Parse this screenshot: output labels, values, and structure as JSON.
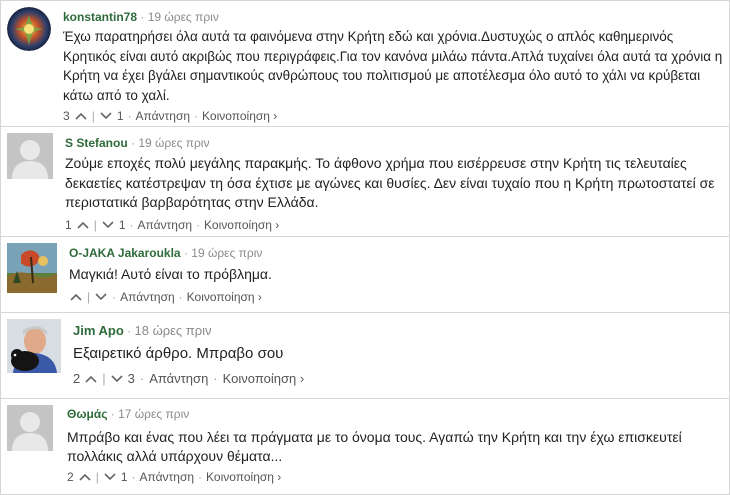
{
  "comments": [
    {
      "author": "konstantin78",
      "separator": "·",
      "time": "19 ώρες πριν",
      "avatar_icon": "colorful-circular-avatar",
      "text": "Έχω παρατηρήσει όλα αυτά τα φαινόμενα στην Κρήτη εδώ και χρόνια.Δυστυχώς ο απλός καθημερινός Κρητικός είναι αυτό ακριβώς που περιγράφεις.Για τον κανόνα μιλάω πάντα.Απλά τυχαίνει όλα αυτά τα χρόνια η Κρήτη να έχει βγάλει σημαντικούς ανθρώπους του πολιτισμού με αποτέλεσμα όλο αυτό το χάλι να κρύβεται κάτω από το χαλί.",
      "upvotes": "3",
      "downvotes": "1",
      "reply_label": "Απάντηση",
      "share_label": "Κοινοποίηση ›"
    },
    {
      "author": "S Stefanou",
      "separator": "·",
      "time": "19 ώρες πριν",
      "avatar_icon": "default-user-silhouette",
      "text": "Ζούμε εποχές πολύ μεγάλης παρακμής. Το άφθονο χρήμα που εισέρρευσε στην Κρήτη τις τελευταίες δεκαετίες κατέστρεψαν τη όσα έχτισε με αγώνες και θυσίες. Δεν είναι τυχαίο που η Κρήτη πρωτοστατεί σε περιστατικά βαρβαρότητας στην Ελλάδα.",
      "upvotes": "1",
      "downvotes": "1",
      "reply_label": "Απάντηση",
      "share_label": "Κοινοποίηση ›"
    },
    {
      "author": "O-JAKA Jakaroukla",
      "separator": "·",
      "time": "19 ώρες πριν",
      "avatar_icon": "painting-avatar",
      "text": "Μαγκιά! Αυτό είναι το πρόβλημα.",
      "upvotes": "",
      "downvotes": "",
      "reply_label": "Απάντηση",
      "share_label": "Κοινοποίηση ›"
    },
    {
      "author": "Jim Apo",
      "separator": "·",
      "time": "18 ώρες πριν",
      "avatar_icon": "photo-man-with-dog-avatar",
      "text": "Εξαιρετικό άρθρο. Μπραβο σου",
      "upvotes": "2",
      "downvotes": "3",
      "reply_label": "Απάντηση",
      "share_label": "Κοινοποίηση ›"
    },
    {
      "author": "Θωμάς",
      "separator": "·",
      "time": "17 ώρες πριν",
      "avatar_icon": "default-user-silhouette",
      "text": "Μπράβο και ένας που λέει τα πράγματα με το όνομα τους. Αγαπώ την Κρήτη και την έχω επισκευτεί πολλάκις αλλά υπάρχουν θέματα...",
      "upvotes": "2",
      "downvotes": "1",
      "reply_label": "Απάντηση",
      "share_label": "Κοινοποίηση ›"
    }
  ],
  "colors": {
    "author": "#2e6b3a",
    "border": "#d6d6d6",
    "muted": "#8a8a8a"
  }
}
